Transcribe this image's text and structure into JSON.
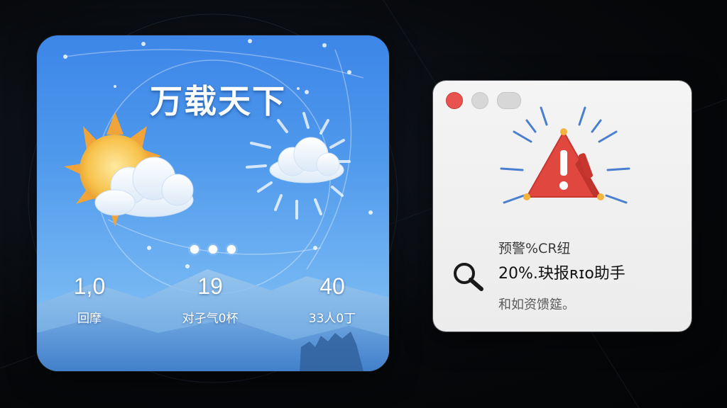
{
  "weather_widget": {
    "title": "万载天下",
    "stats": [
      {
        "value": "1,0",
        "label": "回摩"
      },
      {
        "value": "19",
        "label": "对孑气0杯"
      },
      {
        "value": "40",
        "label": "33人0丁"
      }
    ],
    "icons": [
      "sun-cloud-icon",
      "cloud-rays-icon"
    ],
    "colors": {
      "top": "#3d86e8",
      "bottom": "#8cc6f5"
    }
  },
  "alert_panel": {
    "line1": "预警%CR纽",
    "line2": "20%.玦报ʀɪo助手",
    "line3": "和如资馈筵。",
    "icons": [
      "warning-triangle-icon",
      "search-icon"
    ],
    "colors": {
      "warning": "#e0473f",
      "close": "#e8534f"
    }
  }
}
